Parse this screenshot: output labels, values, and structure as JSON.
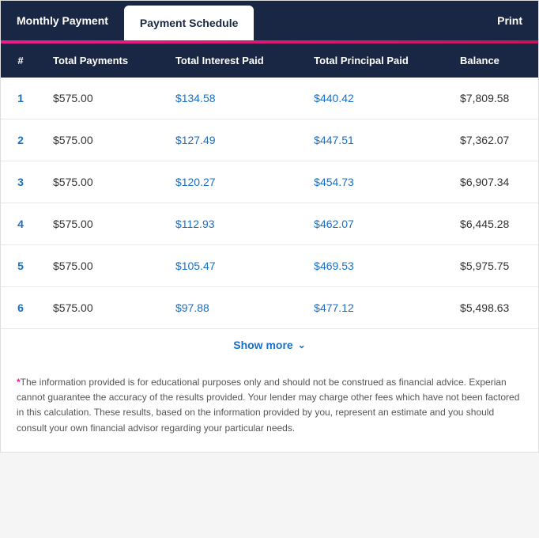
{
  "tabs": [
    {
      "id": "monthly-payment",
      "label": "Monthly Payment",
      "active": false
    },
    {
      "id": "payment-schedule",
      "label": "Payment Schedule",
      "active": true
    }
  ],
  "print_label": "Print",
  "table": {
    "headers": [
      "#",
      "Total Payments",
      "Total Interest Paid",
      "Total Principal Paid",
      "Balance"
    ],
    "rows": [
      {
        "num": "1",
        "total_payments": "$575.00",
        "total_interest": "$134.58",
        "total_principal": "$440.42",
        "balance": "$7,809.58"
      },
      {
        "num": "2",
        "total_payments": "$575.00",
        "total_interest": "$127.49",
        "total_principal": "$447.51",
        "balance": "$7,362.07"
      },
      {
        "num": "3",
        "total_payments": "$575.00",
        "total_interest": "$120.27",
        "total_principal": "$454.73",
        "balance": "$6,907.34"
      },
      {
        "num": "4",
        "total_payments": "$575.00",
        "total_interest": "$112.93",
        "total_principal": "$462.07",
        "balance": "$6,445.28"
      },
      {
        "num": "5",
        "total_payments": "$575.00",
        "total_interest": "$105.47",
        "total_principal": "$469.53",
        "balance": "$5,975.75"
      },
      {
        "num": "6",
        "total_payments": "$575.00",
        "total_interest": "$97.88",
        "total_principal": "$477.12",
        "balance": "$5,498.63"
      }
    ]
  },
  "show_more_label": "Show more",
  "disclaimer": "The information provided is for educational purposes only and should not be construed as financial advice. Experian cannot guarantee the accuracy of the results provided. Your lender may charge other fees which have not been factored in this calculation. These results, based on the information provided by you, represent an estimate and you should consult your own financial advisor regarding your particular needs."
}
